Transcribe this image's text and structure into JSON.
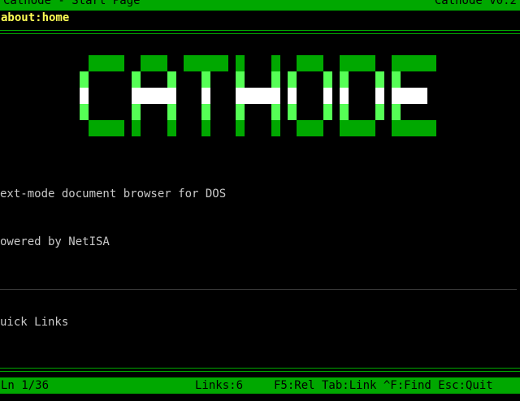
{
  "title_bar": {
    "left": "Cathode - Start Page",
    "right": "Cathode v0.2"
  },
  "url_bar": {
    "url": "about:home"
  },
  "logo": {
    "text": "CATHODE",
    "colors": {
      "dark": "#00a800",
      "light": "#55ff55",
      "white": "#ffffff"
    }
  },
  "content": {
    "tagline": "ext-mode document browser for DOS",
    "powered": "owered by NetISA",
    "quick_links_heading": "uick Links"
  },
  "status_bar": {
    "line": "Ln 1/36",
    "links": "Links:6",
    "help": "F5:Rel Tab:Link ^F:Find Esc:Quit"
  },
  "colors": {
    "accent": "#00a800",
    "url": "#ffff55",
    "text": "#c8c8c8",
    "background": "#000000"
  }
}
